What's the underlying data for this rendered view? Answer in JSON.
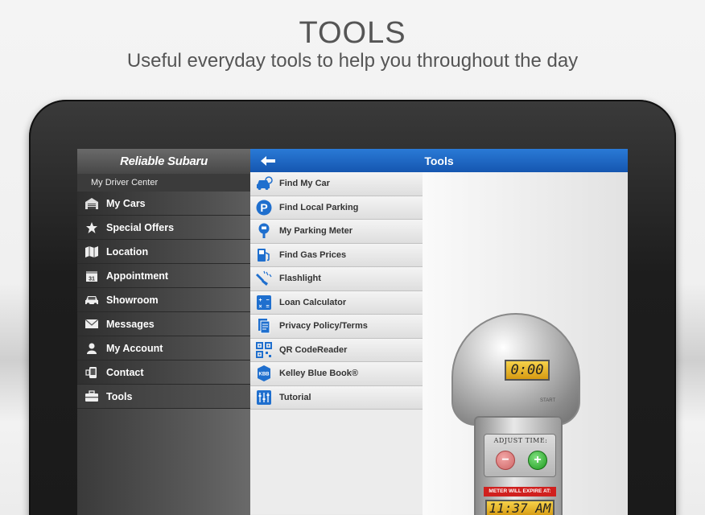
{
  "promo": {
    "title": "TOOLS",
    "subtitle": "Useful everyday tools to help you throughout the day"
  },
  "menu": {
    "brand": "Reliable Subaru",
    "section": "My Driver Center",
    "items": [
      {
        "label": "My Cars",
        "icon": "garage-icon"
      },
      {
        "label": "Special Offers",
        "icon": "star-icon"
      },
      {
        "label": "Location",
        "icon": "map-icon"
      },
      {
        "label": "Appointment",
        "icon": "calendar-icon"
      },
      {
        "label": "Showroom",
        "icon": "car-icon"
      },
      {
        "label": "Messages",
        "icon": "envelope-icon"
      },
      {
        "label": "My Account",
        "icon": "person-icon"
      },
      {
        "label": "Contact",
        "icon": "phone-icon"
      },
      {
        "label": "Tools",
        "icon": "toolbox-icon",
        "active": true
      }
    ]
  },
  "topbar": {
    "title": "Tools",
    "back_icon": "back-arrow-icon"
  },
  "tools": {
    "items": [
      {
        "label": "Find My Car",
        "icon": "find-car-icon"
      },
      {
        "label": "Find Local Parking",
        "icon": "parking-icon"
      },
      {
        "label": "My Parking Meter",
        "icon": "parking-meter-icon"
      },
      {
        "label": "Find Gas Prices",
        "icon": "gas-pump-icon"
      },
      {
        "label": "Flashlight",
        "icon": "flashlight-icon"
      },
      {
        "label": "Loan Calculator",
        "icon": "calculator-icon"
      },
      {
        "label": "Privacy Policy/Terms",
        "icon": "document-icon"
      },
      {
        "label": "QR CodeReader",
        "icon": "qr-code-icon"
      },
      {
        "label": "Kelley Blue Book®",
        "icon": "kbb-icon"
      },
      {
        "label": "Tutorial",
        "icon": "tutorial-icon"
      }
    ]
  },
  "meter": {
    "display": "0:00",
    "start_label": "START",
    "adjust_label": "ADJUST TIME:",
    "minus": "−",
    "plus": "+",
    "expire_label": "METER WILL EXPIRE AT:",
    "expire_time": "11:37 AM"
  },
  "colors": {
    "accent": "#1f6fce",
    "plus_green": "#1d9a1d",
    "minus_red": "#c66",
    "expire_red": "#d0201e"
  }
}
